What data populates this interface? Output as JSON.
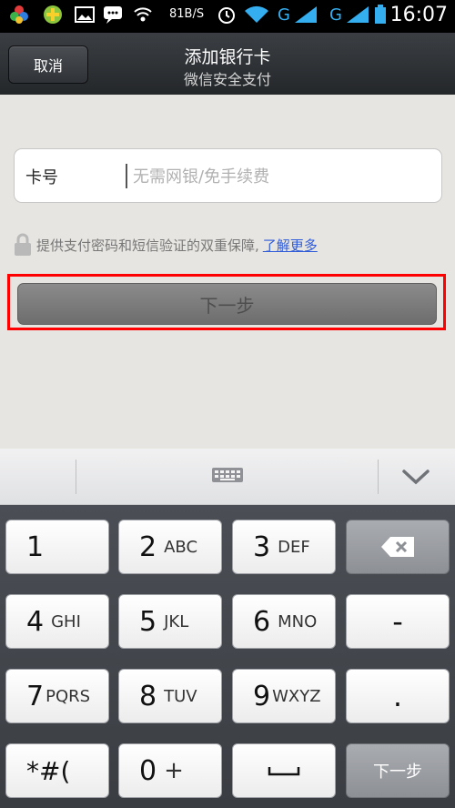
{
  "status_bar": {
    "net_speed": "81B/S",
    "carrier_1": "G",
    "carrier_2": "G",
    "time": "16:07"
  },
  "header": {
    "cancel_label": "取消",
    "title": "添加银行卡",
    "subtitle": "微信安全支付"
  },
  "card_input": {
    "label": "卡号",
    "placeholder": "无需网银/免手续费",
    "value": ""
  },
  "security_note": {
    "text": "提供支付密码和短信验证的双重保障,",
    "link": "了解更多"
  },
  "next_button": {
    "label": "下一步"
  },
  "keyboard": {
    "keys": [
      {
        "num": "1",
        "letters": ""
      },
      {
        "num": "2",
        "letters": "ABC"
      },
      {
        "num": "3",
        "letters": "DEF"
      },
      {
        "num": "4",
        "letters": "GHI"
      },
      {
        "num": "5",
        "letters": "JKL"
      },
      {
        "num": "6",
        "letters": "MNO"
      },
      {
        "num": "7",
        "letters": "PQRS"
      },
      {
        "num": "8",
        "letters": "TUV"
      },
      {
        "num": "9",
        "letters": "WXYZ"
      },
      {
        "num": "*#(",
        "letters": ""
      },
      {
        "num": "0",
        "letters": "+"
      }
    ],
    "side_keys": {
      "minus": "-",
      "dot": ".",
      "next": "下一步"
    }
  },
  "colors": {
    "background": "#e7e5e1",
    "link": "#2f5bd8",
    "highlight_border": "#ff0000"
  }
}
